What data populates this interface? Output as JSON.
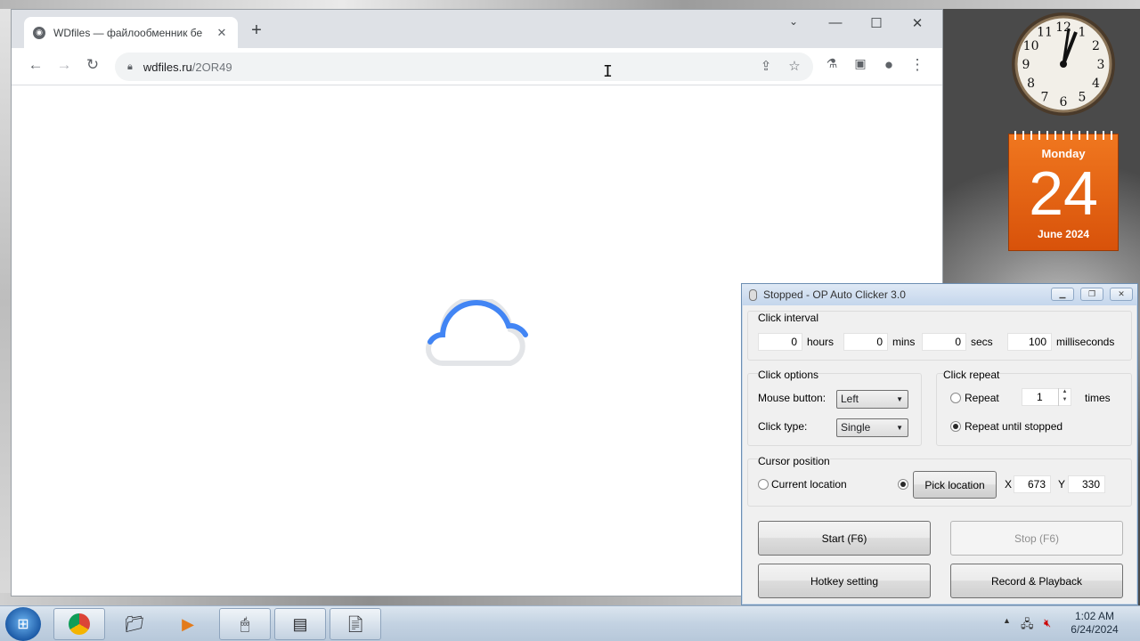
{
  "browser": {
    "tab_title": "WDfiles — файлообменник бе",
    "tab_close": "✕",
    "new_tab": "+",
    "url_host": "wdfiles.ru",
    "url_path": "/2OR49",
    "window_controls": [
      "minimize-icon",
      "maximize-icon",
      "close-icon"
    ]
  },
  "gadgets": {
    "calendar_weekday": "Monday",
    "calendar_day": "24",
    "calendar_month_year": "June 2024",
    "clock_numbers": [
      "12",
      "1",
      "2",
      "3",
      "4",
      "5",
      "6",
      "7",
      "8",
      "9",
      "10",
      "11"
    ]
  },
  "clicker": {
    "title": "Stopped - OP Auto Clicker 3.0",
    "interval": {
      "label": "Click interval",
      "hours": "0",
      "hours_label": "hours",
      "mins": "0",
      "mins_label": "mins",
      "secs": "0",
      "secs_label": "secs",
      "ms": "100",
      "ms_label": "milliseconds"
    },
    "options": {
      "label": "Click options",
      "mouse_button_label": "Mouse button:",
      "mouse_button_value": "Left",
      "click_type_label": "Click type:",
      "click_type_value": "Single"
    },
    "repeat": {
      "label": "Click repeat",
      "repeat_label": "Repeat",
      "repeat_count": "1",
      "times_label": "times",
      "until_stopped_label": "Repeat until stopped",
      "selected": "until_stopped"
    },
    "cursor": {
      "label": "Cursor position",
      "current_label": "Current location",
      "pick_label": "Pick location",
      "x_label": "X",
      "x_value": "673",
      "y_label": "Y",
      "y_value": "330",
      "selected": "pick"
    },
    "buttons": {
      "start": "Start (F6)",
      "stop": "Stop (F6)",
      "hotkey": "Hotkey setting",
      "record": "Record & Playback"
    }
  },
  "taskbar": {
    "time": "1:02 AM",
    "date": "6/24/2024",
    "items": [
      "chrome-icon",
      "folder-icon",
      "media-player-icon",
      "mouse-icon",
      "task-manager-icon",
      "notepad-icon"
    ]
  },
  "colors": {
    "calendar": "#e8651a",
    "chrome_blue": "#4285f4",
    "taskbar": "#c3d2e2"
  }
}
